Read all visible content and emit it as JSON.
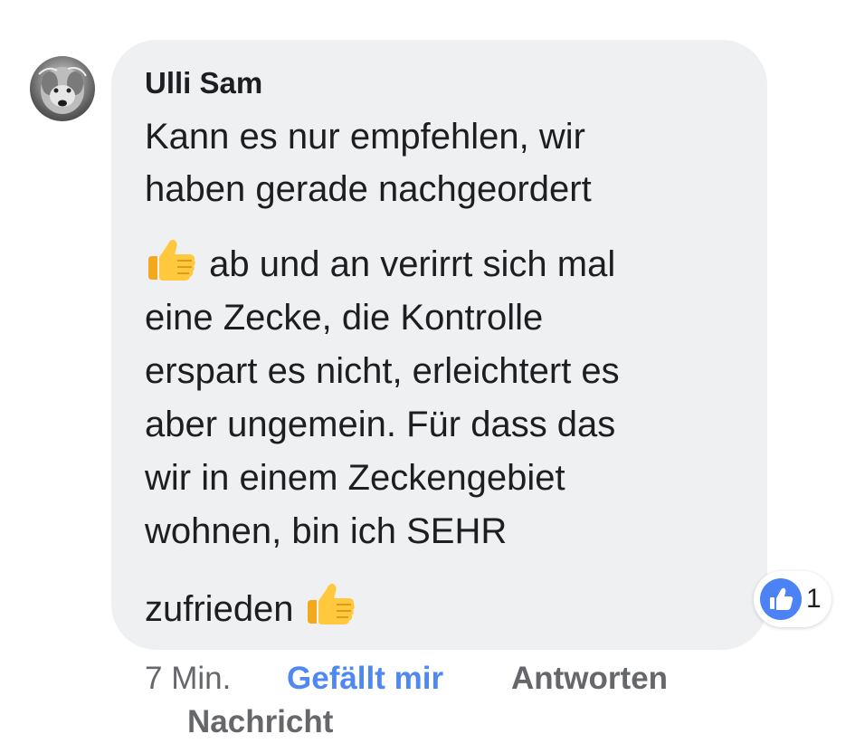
{
  "comment": {
    "author": "Ulli Sam",
    "lines": [
      "Kann es nur empfehlen, wir",
      "haben gerade nachgeordert",
      "ab und an verirrt sich mal",
      "eine Zecke, die Kontrolle",
      "erspart es nicht, erleichtert es",
      "aber ungemein. Für dass das",
      "wir in einem Zeckengebiet",
      "wohnen, bin ich SEHR",
      "zufrieden"
    ],
    "emoji": "thumbs-up-emoji"
  },
  "reaction": {
    "icon": "like-icon",
    "count": "1",
    "color": "#4b82f6"
  },
  "actions": {
    "time": "7 Min.",
    "like_label": "Gefällt mir",
    "reply_label": "Antworten",
    "message_label": "Nachricht"
  },
  "colors": {
    "bubble": "#eff0f2",
    "like_active": "#4e88f0",
    "secondary_text": "#65676b"
  }
}
